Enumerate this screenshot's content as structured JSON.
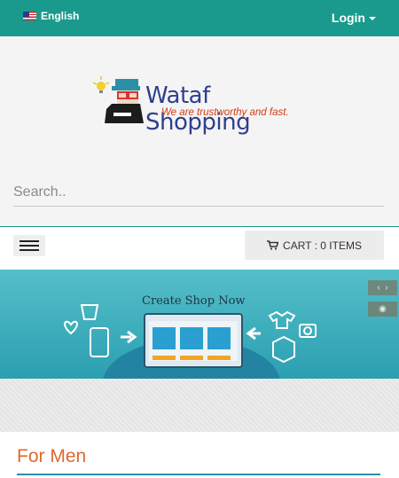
{
  "topbar": {
    "language": "English",
    "login": "Login"
  },
  "logo": {
    "name": "Wataf Shopping",
    "tagline": "We are trustworthy and fast."
  },
  "search": {
    "placeholder": "Search.."
  },
  "cart": {
    "label": "CART : 0 ITEMS"
  },
  "banner": {
    "title": "Create Shop Now"
  },
  "section": {
    "title": "For Men"
  },
  "colors": {
    "primary": "#1a9a8c",
    "accent": "#e0692c",
    "logo_blue": "#2e3f8f",
    "tagline_red": "#d13a1a"
  }
}
